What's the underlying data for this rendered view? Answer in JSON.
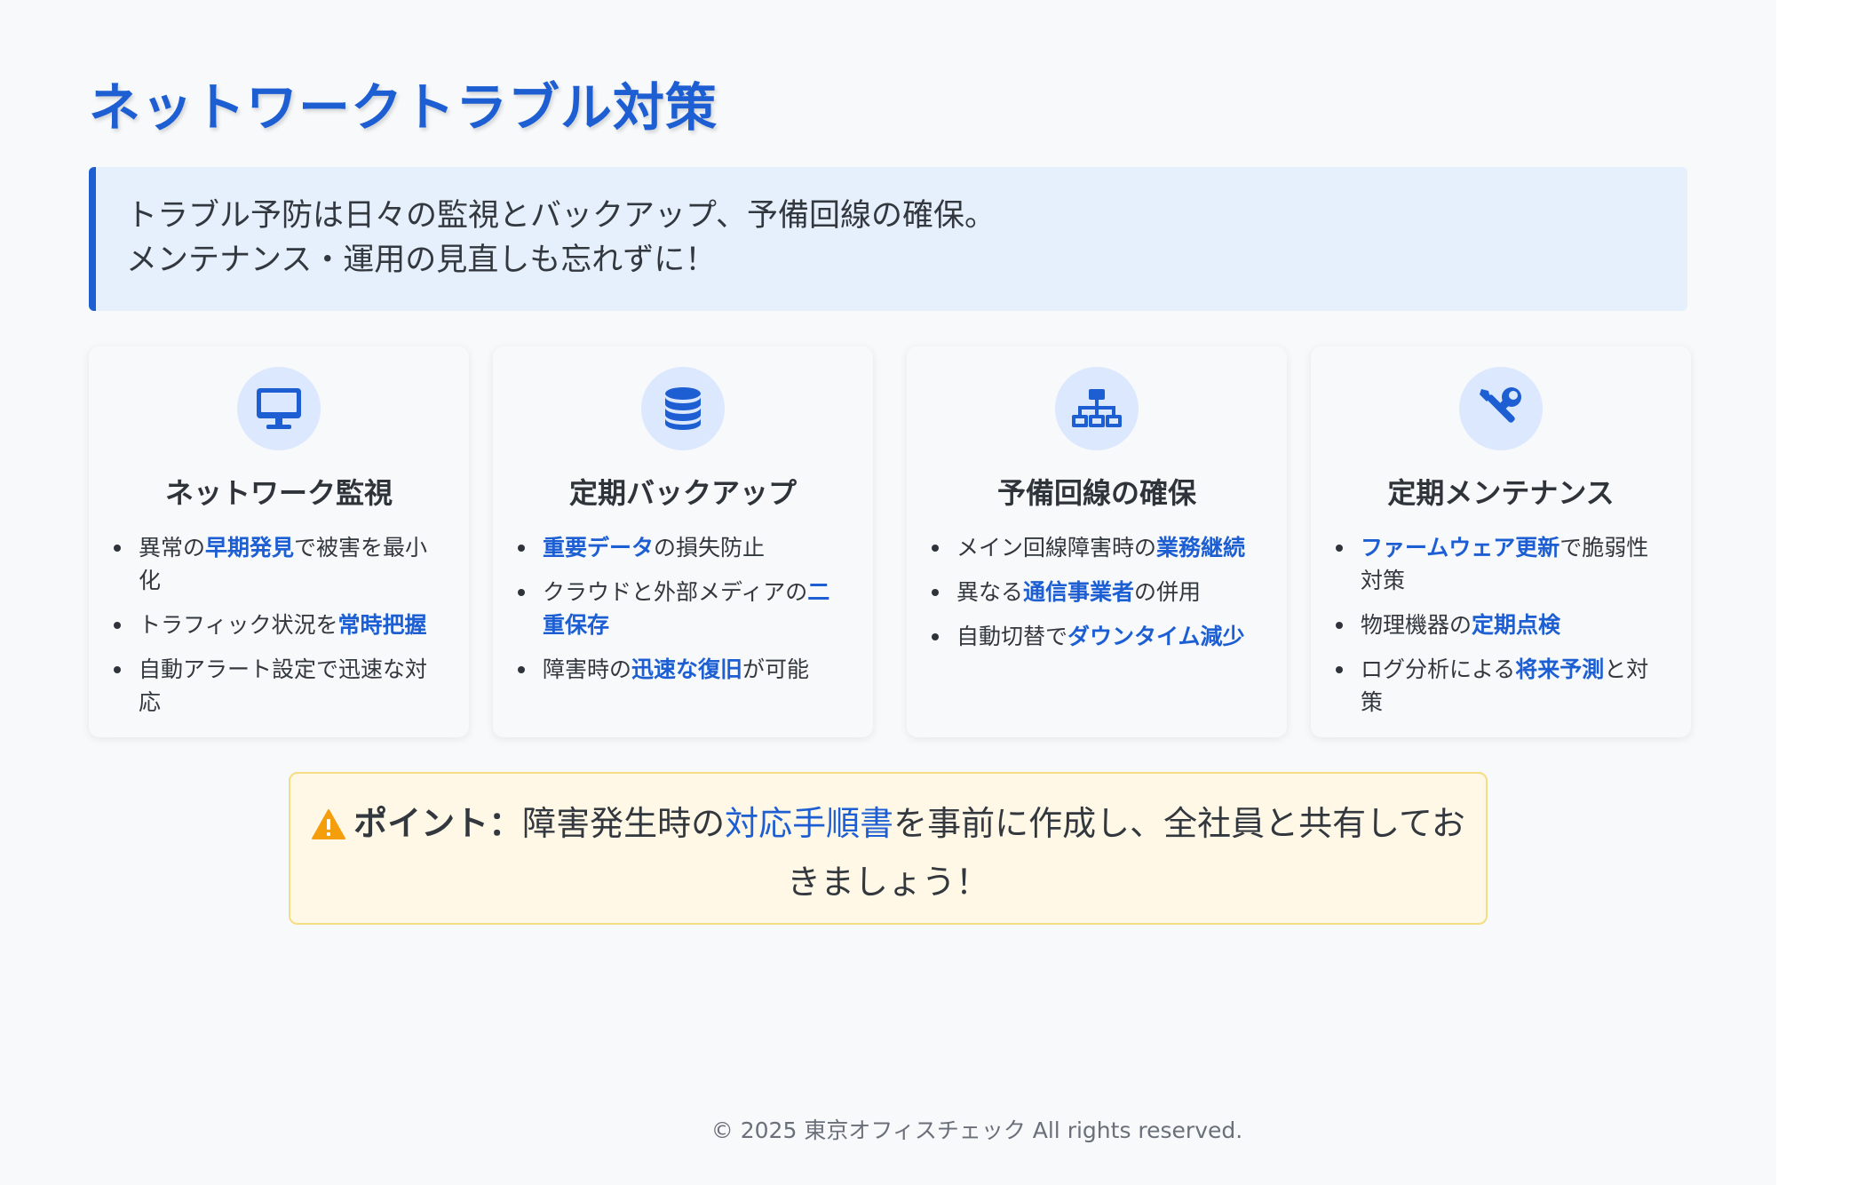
{
  "title": "ネットワークトラブル対策",
  "callout": {
    "line1": "トラブル予防は日々の監視とバックアップ、予備回線の確保。",
    "line2": "メンテナンス・運用の見直しも忘れずに！"
  },
  "cards": [
    {
      "icon": "monitor-icon",
      "title": "ネットワーク監視",
      "items": [
        {
          "pre": "異常の",
          "hl": "早期発見",
          "post": "で被害を最小化"
        },
        {
          "pre": "トラフィック状況を",
          "hl": "常時把握",
          "post": ""
        },
        {
          "pre": "自動アラート設定で迅速な対応",
          "hl": "",
          "post": ""
        }
      ]
    },
    {
      "icon": "database-icon",
      "title": "定期バックアップ",
      "items": [
        {
          "pre": "",
          "hl": "重要データ",
          "post": "の損失防止"
        },
        {
          "pre": "クラウドと外部メディアの",
          "hl": "二重保存",
          "post": ""
        },
        {
          "pre": "障害時の",
          "hl": "迅速な復旧",
          "post": "が可能"
        }
      ]
    },
    {
      "icon": "network-icon",
      "title": "予備回線の確保",
      "items": [
        {
          "pre": "メイン回線障害時の",
          "hl": "業務継続",
          "post": ""
        },
        {
          "pre": "異なる",
          "hl": "通信事業者",
          "post": "の併用"
        },
        {
          "pre": "自動切替で",
          "hl": "ダウンタイム減少",
          "post": ""
        }
      ]
    },
    {
      "icon": "tools-icon",
      "title": "定期メンテナンス",
      "items": [
        {
          "pre": "",
          "hl": "ファームウェア更新",
          "post": "で脆弱性対策"
        },
        {
          "pre": "物理機器の",
          "hl": "定期点検",
          "post": ""
        },
        {
          "pre": "ログ分析による",
          "hl": "将来予測",
          "post": "と対策"
        }
      ]
    }
  ],
  "point": {
    "label": "ポイント：",
    "pre": "障害発生時の",
    "hl": "対応手順書",
    "post": "を事前に作成し、全社員と共有しておきましょう！"
  },
  "footer": "© 2025 東京オフィスチェック All rights reserved.",
  "colors": {
    "accent": "#1d5fd3",
    "callout_bg": "#e6effc",
    "point_bg": "#fff8e6",
    "warning": "#f59e0b"
  }
}
